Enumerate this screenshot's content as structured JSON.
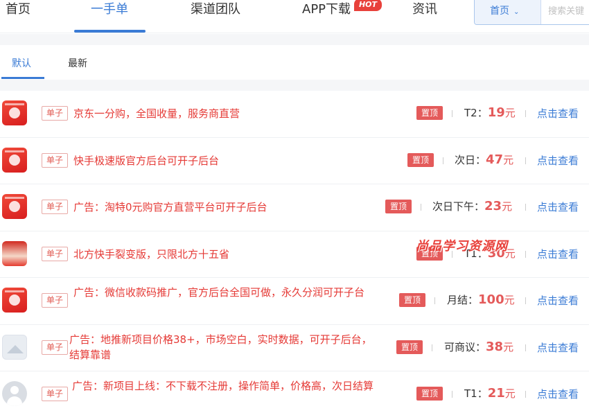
{
  "nav": {
    "items": [
      "首页",
      "一手单",
      "渠道团队",
      "APP下载",
      "资讯"
    ],
    "hot_badge": "HOT",
    "search_select": "首页",
    "search_placeholder": "搜索关键"
  },
  "subtabs": [
    "默认",
    "最新"
  ],
  "tag_label": "单子",
  "pin_label": "置顶",
  "view_label": "点击查看",
  "rows": [
    {
      "title": "京东一分购，全国收量，服务商直营",
      "settle": "T2：",
      "price": "19",
      "unit": "元",
      "thumb": "red-app-icon"
    },
    {
      "title": "快手极速版官方后台可开子后台",
      "settle": "次日：",
      "price": "47",
      "unit": "元",
      "thumb": "red-app-icon"
    },
    {
      "title": "广告：淘特0元购官方直营平台可开子后台",
      "settle": "次日下午：",
      "price": "23",
      "unit": "元",
      "thumb": "red-app-icon"
    },
    {
      "title": "北方快手裂变版，只限北方十五省",
      "settle": "T1：",
      "price": "30",
      "unit": "元",
      "thumb": "photo-thumb"
    },
    {
      "title": "广告：微信收款码推广，官方后台全国可做，永久分润可开子台",
      "settle": "月结：",
      "price": "100",
      "unit": "元",
      "thumb": "red-app-icon"
    },
    {
      "title": "广告：地推新项目价格38+，市场空白，实时数据，可开子后台，结算靠谱",
      "settle": "可商议：",
      "price": "38",
      "unit": "元",
      "thumb": "placeholder-image"
    },
    {
      "title": "广告：新项目上线：不下载不注册，操作简单，价格高，次日结算",
      "settle": "T1：",
      "price": "21",
      "unit": "元",
      "thumb": "default-avatar"
    }
  ],
  "watermark": "尚品学习资源网",
  "colors": {
    "accent": "#3a7bd5",
    "title_red": "#e53935",
    "pin_red": "#e45a5a"
  }
}
